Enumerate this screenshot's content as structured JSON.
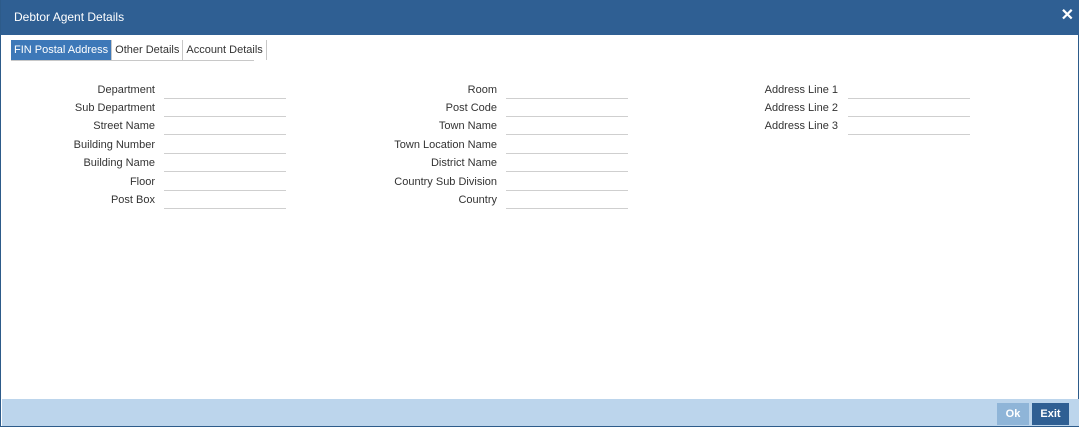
{
  "window": {
    "title": "Debtor Agent Details",
    "close_icon": "close-icon",
    "close_glyph": "✕"
  },
  "tabs": [
    {
      "label": "FIN Postal Address",
      "active": true
    },
    {
      "label": "Other Details",
      "active": false
    },
    {
      "label": "Account Details",
      "active": false
    }
  ],
  "form": {
    "col1": [
      {
        "label": "Department",
        "value": ""
      },
      {
        "label": "Sub Department",
        "value": ""
      },
      {
        "label": "Street Name",
        "value": ""
      },
      {
        "label": "Building Number",
        "value": ""
      },
      {
        "label": "Building Name",
        "value": ""
      },
      {
        "label": "Floor",
        "value": ""
      },
      {
        "label": "Post Box",
        "value": ""
      }
    ],
    "col2": [
      {
        "label": "Room",
        "value": ""
      },
      {
        "label": "Post Code",
        "value": ""
      },
      {
        "label": "Town Name",
        "value": ""
      },
      {
        "label": "Town Location Name",
        "value": ""
      },
      {
        "label": "District Name",
        "value": ""
      },
      {
        "label": "Country Sub Division",
        "value": ""
      },
      {
        "label": "Country",
        "value": ""
      }
    ],
    "col3": [
      {
        "label": "Address Line 1",
        "value": ""
      },
      {
        "label": "Address Line 2",
        "value": ""
      },
      {
        "label": "Address Line 3",
        "value": ""
      }
    ]
  },
  "footer": {
    "ok_label": "Ok",
    "exit_label": "Exit"
  },
  "colors": {
    "titlebar": "#2f5f93",
    "active_tab": "#3d78b8",
    "footer": "#bcd5ec",
    "ok_button_disabled": "#8fb5d8",
    "exit_button": "#2f5f93"
  }
}
